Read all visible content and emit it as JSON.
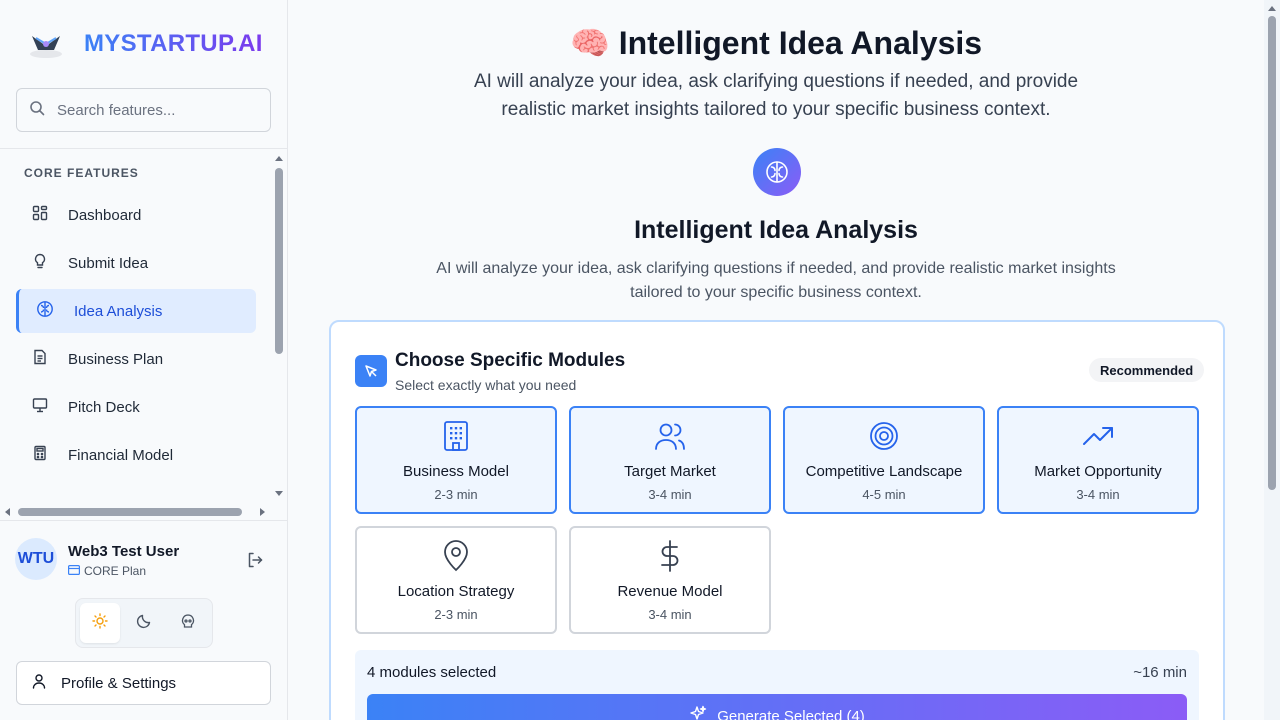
{
  "brand": {
    "name": "MYSTARTUP.AI"
  },
  "search": {
    "placeholder": "Search features..."
  },
  "sidebar": {
    "section_title": "CORE FEATURES",
    "items": [
      {
        "label": "Dashboard",
        "icon": "dashboard-icon"
      },
      {
        "label": "Submit Idea",
        "icon": "lightbulb-icon"
      },
      {
        "label": "Idea Analysis",
        "icon": "brain-icon",
        "active": true
      },
      {
        "label": "Business Plan",
        "icon": "document-icon"
      },
      {
        "label": "Pitch Deck",
        "icon": "presentation-icon"
      },
      {
        "label": "Financial Model",
        "icon": "calculator-icon"
      }
    ]
  },
  "user": {
    "initials": "WTU",
    "name": "Web3 Test User",
    "plan": "CORE Plan"
  },
  "profile_button": {
    "label": "Profile & Settings"
  },
  "header": {
    "title": "🧠 Intelligent Idea Analysis",
    "subtitle": "AI will analyze your idea, ask clarifying questions if needed, and provide realistic market insights tailored to your specific business context."
  },
  "section": {
    "title": "Intelligent Idea Analysis",
    "subtitle": "AI will analyze your idea, ask clarifying questions if needed, and provide realistic market insights tailored to your specific business context."
  },
  "modules_card": {
    "title": "Choose Specific Modules",
    "subtitle": "Select exactly what you need",
    "badge": "Recommended",
    "modules": [
      {
        "title": "Business Model",
        "time": "2-3 min",
        "selected": true,
        "icon": "building-icon"
      },
      {
        "title": "Target Market",
        "time": "3-4 min",
        "selected": true,
        "icon": "users-icon"
      },
      {
        "title": "Competitive Landscape",
        "time": "4-5 min",
        "selected": true,
        "icon": "target-icon"
      },
      {
        "title": "Market Opportunity",
        "time": "3-4 min",
        "selected": true,
        "icon": "trending-up-icon"
      },
      {
        "title": "Location Strategy",
        "time": "2-3 min",
        "selected": false,
        "icon": "map-pin-icon"
      },
      {
        "title": "Revenue Model",
        "time": "3-4 min",
        "selected": false,
        "icon": "dollar-icon"
      }
    ],
    "summary_left": "4 modules selected",
    "summary_right": "~16 min",
    "generate_label": "Generate Selected (4)"
  },
  "colors": {
    "accent": "#3b82f6",
    "accent2": "#8b5cf6",
    "selected_bg": "#eff6ff"
  }
}
